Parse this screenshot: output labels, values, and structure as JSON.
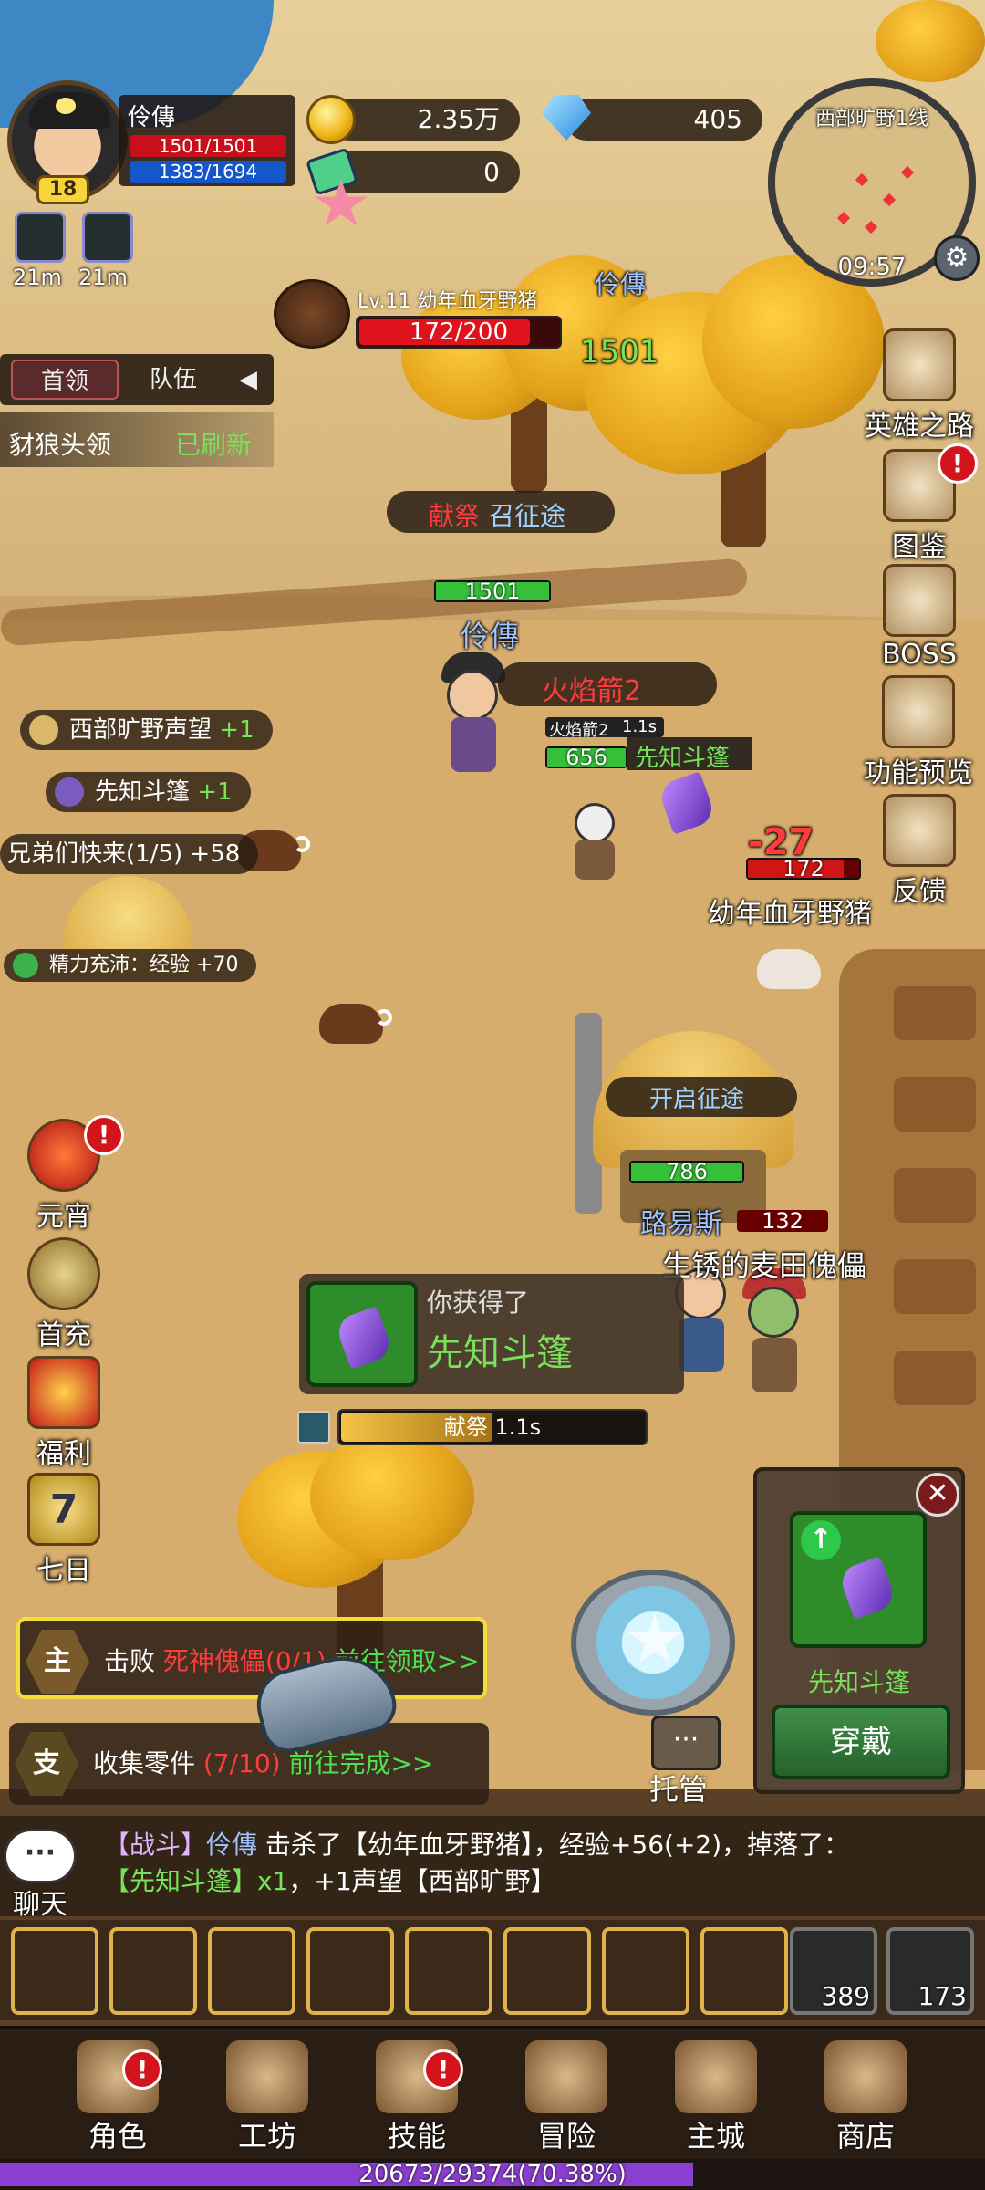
{
  "player": {
    "name": "伶傳",
    "level": "18",
    "hp": "1501/1501",
    "mp": "1383/1694",
    "hp_fraction": 1.0,
    "mp_fraction": 0.816,
    "buffs": [
      {
        "icon": "fang-icon",
        "time": "21m"
      },
      {
        "icon": "crystal-icon",
        "time": "21m"
      }
    ]
  },
  "currency": {
    "gold": "2.35万",
    "gems": "405",
    "tickets": "0"
  },
  "minimap": {
    "map_name": "西部旷野1线",
    "time": "09:57"
  },
  "target": {
    "name": "Lv.11 幼年血牙野猪",
    "hp": "172/200",
    "hp_fraction": 0.86
  },
  "tabs": {
    "leader": "首领",
    "team": "队伍"
  },
  "leader_quest": {
    "name": "豺狼头领",
    "status": "已刷新"
  },
  "world": {
    "player_top_name": "伶傳",
    "player_top_hp": "1501",
    "skill_banner_1": "献祭",
    "skill_banner_1_rest": "召征途",
    "player_hp_label": "1501",
    "player_name_label": "伶傳",
    "fire_arrow": "火焰箭2",
    "cast_small": "火焰箭2",
    "cast_small_time": "1.1s",
    "ally_hp": "656",
    "ally_item": "先知斗篷",
    "damage": "-27",
    "boar_hp": "172",
    "boar_name": "幼年血牙野猪",
    "npc_banner": "开启征途",
    "npc_hp": "786",
    "npc_name": "路易斯",
    "npc_hp2": "132",
    "scarecrow_name": "生锈的麦田傀儡"
  },
  "notifications": [
    {
      "text": "西部旷野声望",
      "bonus": "+1"
    },
    {
      "text": "先知斗篷",
      "bonus": "+1"
    },
    {
      "text": "兄弟们快来(1/5)",
      "bonus": "+58"
    },
    {
      "text": "精力充沛：经验",
      "bonus": "+70"
    }
  ],
  "right_menu": [
    {
      "icon": "hero-road-icon",
      "label": "英雄之路",
      "badge": ""
    },
    {
      "icon": "book-icon",
      "label": "图鉴",
      "badge": "!"
    },
    {
      "icon": "boss-icon",
      "label": "BOSS",
      "badge": ""
    },
    {
      "icon": "scroll-icon",
      "label": "功能预览",
      "badge": ""
    },
    {
      "icon": "letter-icon",
      "label": "反馈",
      "badge": ""
    }
  ],
  "left_menu": [
    {
      "icon": "lantern-icon",
      "label": "元宵",
      "badge": "!"
    },
    {
      "icon": "money-bag-icon",
      "label": "首充",
      "badge": ""
    },
    {
      "icon": "gift-icon",
      "label": "福利",
      "badge": ""
    },
    {
      "icon": "shield-seven-icon",
      "label": "七日",
      "badge": "",
      "num": "7"
    }
  ],
  "loot": {
    "title": "你获得了",
    "item": "先知斗篷"
  },
  "cast_bar": {
    "skill": "献祭",
    "time": "1.1s",
    "progress": 0.5
  },
  "tasks": [
    {
      "tag": "主",
      "prefix": "击败 ",
      "target": "死神傀儡",
      "count": "(0/1)",
      "action": "前往领取>>"
    },
    {
      "tag": "支",
      "prefix": "收集零件 ",
      "target": "",
      "count": "(7/10)",
      "action": "前往完成>>"
    }
  ],
  "equip_popup": {
    "item": "先知斗篷",
    "button": "穿戴",
    "close": "✕"
  },
  "managed": {
    "label": "托管"
  },
  "chat": {
    "label": "聊天",
    "bubble": "···",
    "line1_channel": "【战斗】",
    "line1_name": "伶傳",
    "line1_text": " 击杀了【幼年血牙野猪】，经验+56(+2)，掉落了：",
    "line2_item": "【先知斗篷】x1",
    "line2_text": "，+1声望【西部旷野】"
  },
  "skills": [
    {
      "icon": "poison-bolt-icon",
      "color": "#3a1a4a"
    },
    {
      "icon": "troll-rage-icon",
      "color": "#4a6a2a"
    },
    {
      "icon": "vortex-icon",
      "color": "#5a5a8a"
    },
    {
      "icon": "mask-icon",
      "color": "#2a6a3a"
    },
    {
      "icon": "fang-icon",
      "color": "#3a4a5a"
    },
    {
      "icon": "claw-icon",
      "color": "#1a3a4a"
    },
    {
      "icon": "swap-icon",
      "color": "#5a2a1a"
    },
    {
      "icon": "spore-icon",
      "color": "#2a5a1a"
    }
  ],
  "items": [
    {
      "icon": "meat-icon",
      "count": "389"
    },
    {
      "icon": "potion-icon",
      "count": "173"
    }
  ],
  "bottom_nav": [
    {
      "icon": "character-icon",
      "label": "角色",
      "badge": "!"
    },
    {
      "icon": "anvil-icon",
      "label": "工坊",
      "badge": ""
    },
    {
      "icon": "skill-book-icon",
      "label": "技能",
      "badge": "!"
    },
    {
      "icon": "map-scroll-icon",
      "label": "冒险",
      "badge": ""
    },
    {
      "icon": "castle-icon",
      "label": "主城",
      "badge": ""
    },
    {
      "icon": "shop-icon",
      "label": "商店",
      "badge": ""
    }
  ],
  "xp": {
    "text": "20673/29374(70.38%)",
    "fraction": 0.7038
  }
}
